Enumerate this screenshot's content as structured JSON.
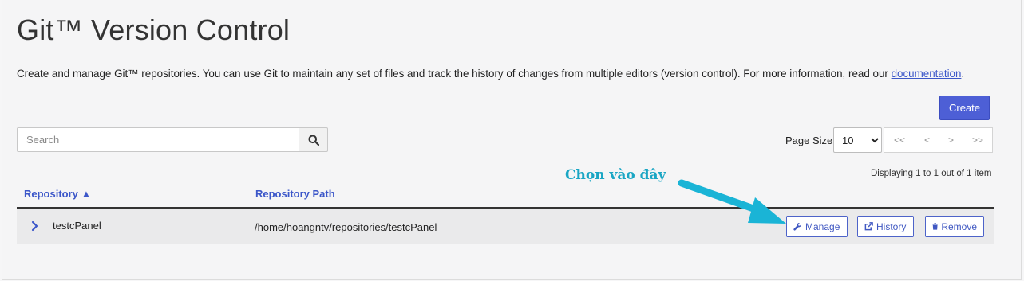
{
  "page": {
    "title": "Git™ Version Control",
    "description_text": "Create and manage Git™ repositories. You can use Git to maintain any set of files and track the history of changes from multiple editors (version control). For more information, read our ",
    "description_link": "documentation",
    "description_end": "."
  },
  "toolbar": {
    "create_label": "Create",
    "search_placeholder": "Search",
    "page_size_label": "Page Size",
    "page_size_value": "10",
    "pager": [
      "<<",
      "<",
      ">",
      ">>"
    ],
    "displaying": "Displaying 1 to 1 out of 1 item"
  },
  "table": {
    "columns": [
      "Repository ▲",
      "Repository Path"
    ],
    "rows": [
      {
        "name": "testcPanel",
        "path": "/home/hoangntv/repositories/testcPanel",
        "actions": {
          "manage": "Manage",
          "history": "History",
          "remove": "Remove"
        }
      }
    ]
  },
  "annotation": {
    "text": "Chọn vào đây"
  },
  "colors": {
    "accent": "#4d5fd6",
    "link": "#3c57c9",
    "annotation": "#1aa6c4"
  },
  "icons": [
    "search-icon",
    "chevron-right-icon",
    "wrench-icon",
    "external-link-icon",
    "trash-icon"
  ]
}
